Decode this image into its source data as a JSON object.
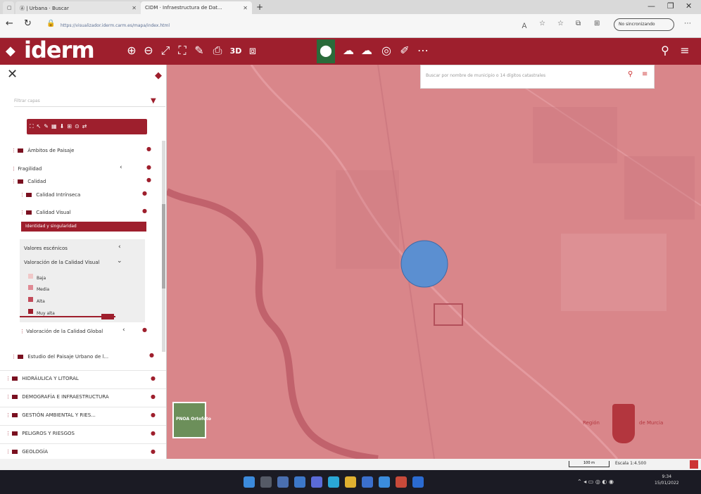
{
  "browser": {
    "tabs": [
      {
        "label": "Ⓐ | Urbana · Buscar"
      },
      {
        "label": "CIDM · Infraestructura de Dat..."
      }
    ],
    "new_tab": "+",
    "url": "https://visualizador.iderm.carm.es/mapa/index.html",
    "private_label": "No sincronizando"
  },
  "app": {
    "logo_text": "iderm",
    "tools_text": [
      "3D"
    ]
  },
  "search": {
    "placeholder": "Buscar por nombre de municipio o 14 dígitos catastrales"
  },
  "sidebar": {
    "filter_placeholder": "Filtrar capas",
    "tree": [
      {
        "label": "Ámbitos de Paisaje"
      },
      {
        "label": "Fragilidad"
      },
      {
        "label": "Calidad"
      },
      {
        "label": "Calidad Intrínseca"
      },
      {
        "label": "Calidad Visual"
      }
    ],
    "selected_layer": "Identidad y singularidad",
    "sub_items": [
      {
        "label": "Valores escénicos"
      },
      {
        "label": "Valoración de la Calidad Visual"
      }
    ],
    "legend": [
      {
        "label": "Baja",
        "color": "#f0c8c8"
      },
      {
        "label": "Media",
        "color": "#e08a94"
      },
      {
        "label": "Alta",
        "color": "#c24b5a"
      },
      {
        "label": "Muy alta",
        "color": "#9e1f2d"
      }
    ],
    "after_legend": "Valoración de la Calidad Global",
    "group_last": "Estudio del Paisaje Urbano de l...",
    "groups": [
      {
        "label": "HIDRÁULICA Y LITORAL"
      },
      {
        "label": "DEMOGRAFÍA E INFRAESTRUCTURA"
      },
      {
        "label": "GESTIÓN AMBIENTAL Y RIES..."
      },
      {
        "label": "PELIGROS Y RIESGOS"
      },
      {
        "label": "GEOLOGÍA"
      }
    ]
  },
  "map": {
    "basemap_label": "PNOA Ortofoto",
    "region_left": "Región",
    "region_right": "de Murcia",
    "marker_color": "#5b8fd1"
  },
  "status": {
    "scale_label": "100 m",
    "coord_label": "Escala 1:4.500"
  },
  "taskbar": {
    "time": "9:34",
    "date": "15/01/2022"
  },
  "colors": {
    "brand": "#9e1f2d",
    "map_tint": "#d9868a"
  }
}
